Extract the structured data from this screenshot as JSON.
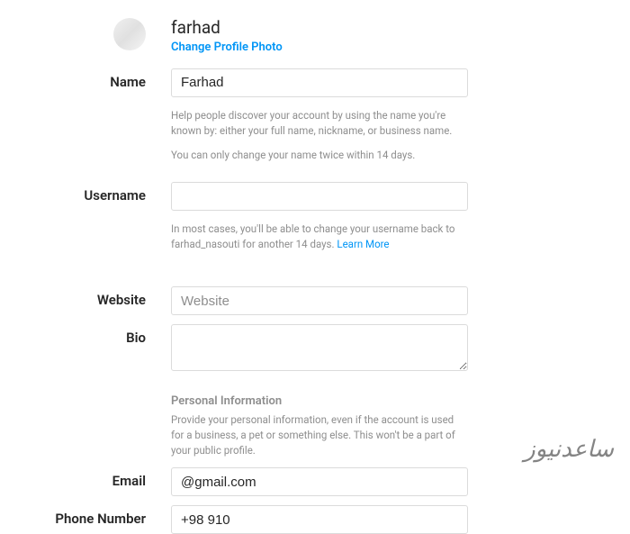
{
  "header": {
    "username_display": "farhad",
    "change_photo_label": "Change Profile Photo"
  },
  "labels": {
    "name": "Name",
    "username": "Username",
    "website": "Website",
    "bio": "Bio",
    "email": "Email",
    "phone": "Phone Number"
  },
  "fields": {
    "name_value": "Farhad",
    "username_value": "",
    "website_value": "",
    "website_placeholder": "Website",
    "bio_value": "",
    "email_value": "@gmail.com",
    "phone_value": "+98 910"
  },
  "help": {
    "name_line1": "Help people discover your account by using the name you're known by: either your full name, nickname, or business name.",
    "name_line2": "You can only change your name twice within 14 days.",
    "username_text": "In most cases, you'll be able to change your username back to farhad_nasouti for another 14 days. ",
    "learn_more": "Learn More",
    "personal_heading": "Personal Information",
    "personal_text": "Provide your personal information, even if the account is used for a business, a pet or something else. This won't be a part of your public profile."
  },
  "watermark": "ساعدنیوز"
}
